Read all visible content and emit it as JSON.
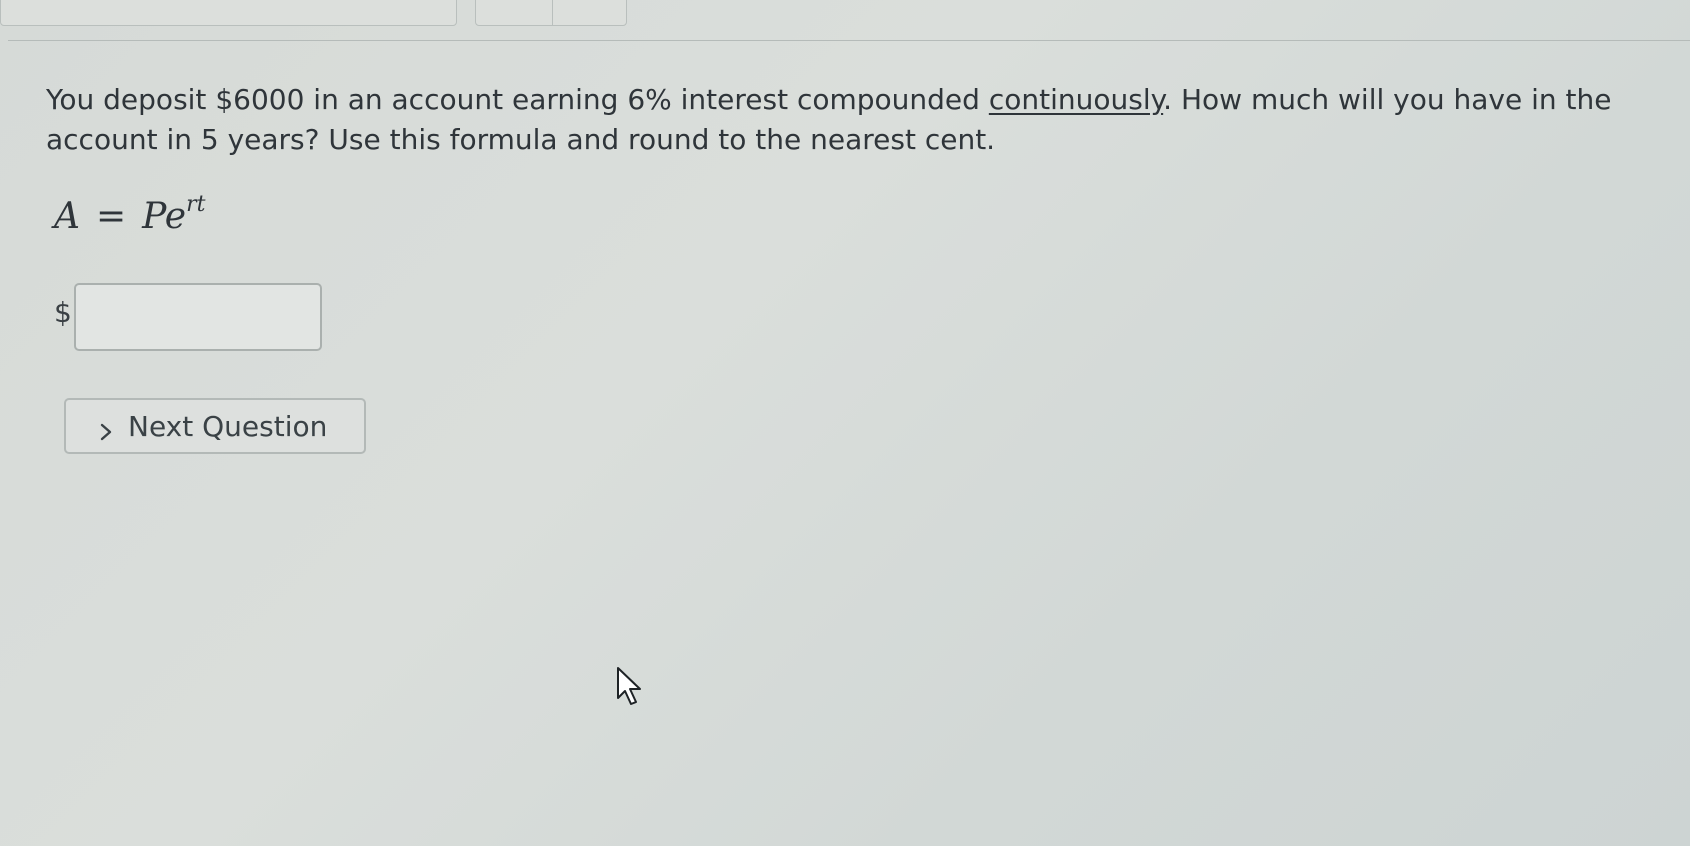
{
  "question": {
    "text_before": "You deposit $6000 in an account earning 6% interest compounded ",
    "underlined_word": "continuously",
    "text_after": ". How much will you have in the account in 5 years? Use this formula and round to the nearest cent."
  },
  "formula": {
    "lhs": "A",
    "equals": "=",
    "base": "Pe",
    "exponent": "rt"
  },
  "answer": {
    "currency_symbol": "$",
    "value": "",
    "placeholder": ""
  },
  "next_button": {
    "icon": "chevron-right-icon",
    "label": "Next Question"
  },
  "pointer": {
    "icon": "mouse-cursor-icon"
  }
}
